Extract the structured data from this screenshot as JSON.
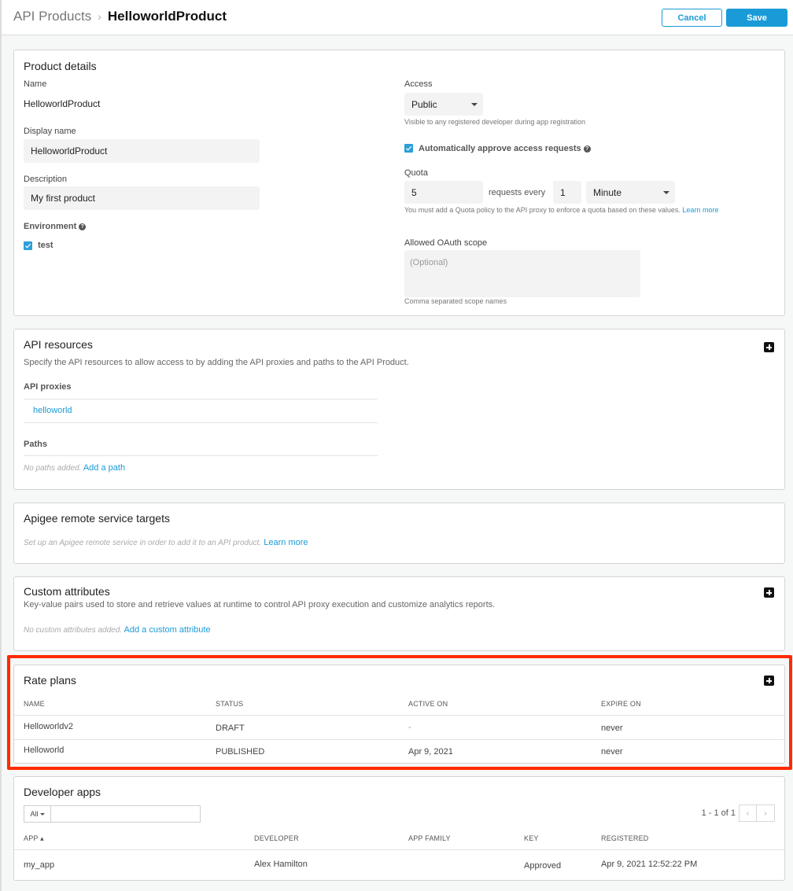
{
  "header": {
    "breadcrumb_parent": "API Products",
    "breadcrumb_separator": "›",
    "breadcrumb_current": "HelloworldProduct",
    "cancel_label": "Cancel",
    "save_label": "Save"
  },
  "product_details": {
    "title": "Product details",
    "name_label": "Name",
    "name_value": "HelloworldProduct",
    "display_name_label": "Display name",
    "display_name_value": "HelloworldProduct",
    "description_label": "Description",
    "description_value": "My first product",
    "environment_label": "Environment",
    "environment_option": "test",
    "environment_checked": true,
    "access_label": "Access",
    "access_value": "Public",
    "access_hint": "Visible to any registered developer during app registration",
    "auto_approve_label": "Automatically approve access requests",
    "auto_approve_checked": true,
    "quota_label": "Quota",
    "quota_requests": "5",
    "quota_requests_every_label": "requests every",
    "quota_interval": "1",
    "quota_unit": "Minute",
    "quota_hint": "You must add a Quota policy to the API proxy to enforce a quota based on these values.",
    "quota_learn_more": "Learn more",
    "oauth_label": "Allowed OAuth scope",
    "oauth_placeholder": "(Optional)",
    "oauth_hint": "Comma separated scope names",
    "help_glyph": "?"
  },
  "api_resources": {
    "title": "API resources",
    "description": "Specify the API resources to allow access to by adding the API proxies and paths to the API Product.",
    "proxies_label": "API proxies",
    "proxies": [
      "helloworld"
    ],
    "paths_label": "Paths",
    "paths_empty": "No paths added.",
    "add_path": "Add a path"
  },
  "remote_targets": {
    "title": "Apigee remote service targets",
    "description": "Set up an Apigee remote service in order to add it to an API product.",
    "learn_more": "Learn more"
  },
  "custom_attributes": {
    "title": "Custom attributes",
    "description": "Key-value pairs used to store and retrieve values at runtime to control API proxy execution and customize analytics reports.",
    "empty": "No custom attributes added.",
    "add_link": "Add a custom attribute"
  },
  "rate_plans": {
    "title": "Rate plans",
    "columns": [
      "NAME",
      "STATUS",
      "ACTIVE ON",
      "EXPIRE ON"
    ],
    "rows": [
      {
        "name": "Helloworldv2",
        "status": "DRAFT",
        "active_on": "-",
        "expire_on": "never"
      },
      {
        "name": "Helloworld",
        "status": "PUBLISHED",
        "active_on": "Apr 9, 2021",
        "expire_on": "never"
      }
    ],
    "highlight_color": "#ff2a00"
  },
  "developer_apps": {
    "title": "Developer apps",
    "filter_option": "All",
    "filter_value": "",
    "pagination": "1 - 1 of 1",
    "prev_glyph": "‹",
    "next_glyph": "›",
    "columns": [
      "APP ▴",
      "DEVELOPER",
      "APP FAMILY",
      "KEY",
      "REGISTERED"
    ],
    "rows": [
      {
        "app": "my_app",
        "developer": "Alex Hamilton",
        "app_family": "",
        "key": "Approved",
        "registered": "Apr 9, 2021 12:52:22 PM"
      }
    ]
  },
  "colors": {
    "accent": "#1a9bd7",
    "checkbox": "#2d9fd9"
  }
}
